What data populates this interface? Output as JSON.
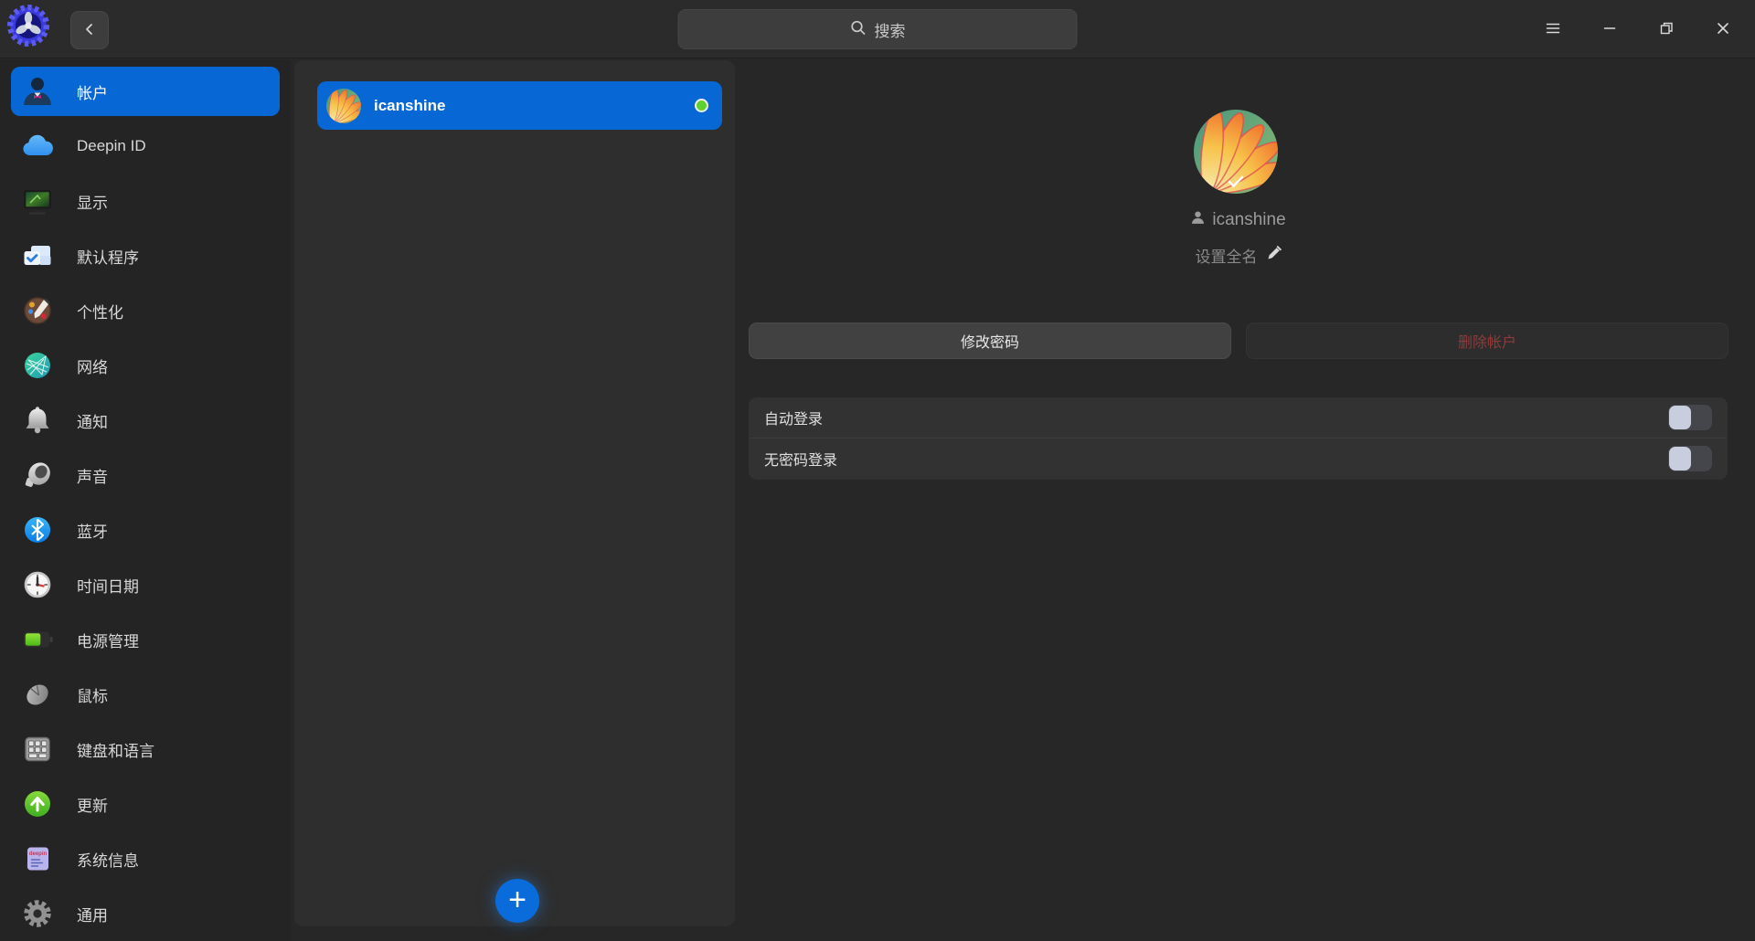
{
  "topbar": {
    "search_placeholder": "搜索",
    "icons": {
      "logo": "control-center-gear-logo",
      "back": "chevron-left-icon",
      "search": "search-icon"
    },
    "window_controls": [
      "menu-icon",
      "minimize-icon",
      "maximize-icon",
      "close-icon"
    ]
  },
  "sidebar": {
    "items": [
      {
        "label": "帐户",
        "icon": "user-icon",
        "selected": true
      },
      {
        "label": "Deepin ID",
        "icon": "cloud-icon",
        "selected": false
      },
      {
        "label": "显示",
        "icon": "display-icon",
        "selected": false
      },
      {
        "label": "默认程序",
        "icon": "default-apps-icon",
        "selected": false
      },
      {
        "label": "个性化",
        "icon": "palette-icon",
        "selected": false
      },
      {
        "label": "网络",
        "icon": "network-globe-icon",
        "selected": false
      },
      {
        "label": "通知",
        "icon": "bell-icon",
        "selected": false
      },
      {
        "label": "声音",
        "icon": "speaker-icon",
        "selected": false
      },
      {
        "label": "蓝牙",
        "icon": "bluetooth-icon",
        "selected": false
      },
      {
        "label": "时间日期",
        "icon": "clock-icon",
        "selected": false
      },
      {
        "label": "电源管理",
        "icon": "battery-icon",
        "selected": false
      },
      {
        "label": "鼠标",
        "icon": "mouse-icon",
        "selected": false
      },
      {
        "label": "键盘和语言",
        "icon": "keyboard-icon",
        "selected": false
      },
      {
        "label": "更新",
        "icon": "update-arrow-icon",
        "selected": false
      },
      {
        "label": "系统信息",
        "icon": "system-info-icon",
        "selected": false
      },
      {
        "label": "通用",
        "icon": "gear-icon",
        "selected": false
      }
    ]
  },
  "user_list": {
    "users": [
      {
        "name": "icanshine",
        "status": "online"
      }
    ],
    "add_label": "+"
  },
  "detail": {
    "username": "icanshine",
    "set_fullname_label": "设置全名",
    "change_password_label": "修改密码",
    "delete_account_label": "删除帐户",
    "settings": [
      {
        "label": "自动登录",
        "enabled": false
      },
      {
        "label": "无密码登录",
        "enabled": false
      }
    ]
  },
  "colors": {
    "accent_blue": "#0767d4",
    "online_green": "#5fd02f",
    "danger_text": "#8f3b3b",
    "panel_bg": "#2e2e2e",
    "window_bg": "#272727"
  }
}
